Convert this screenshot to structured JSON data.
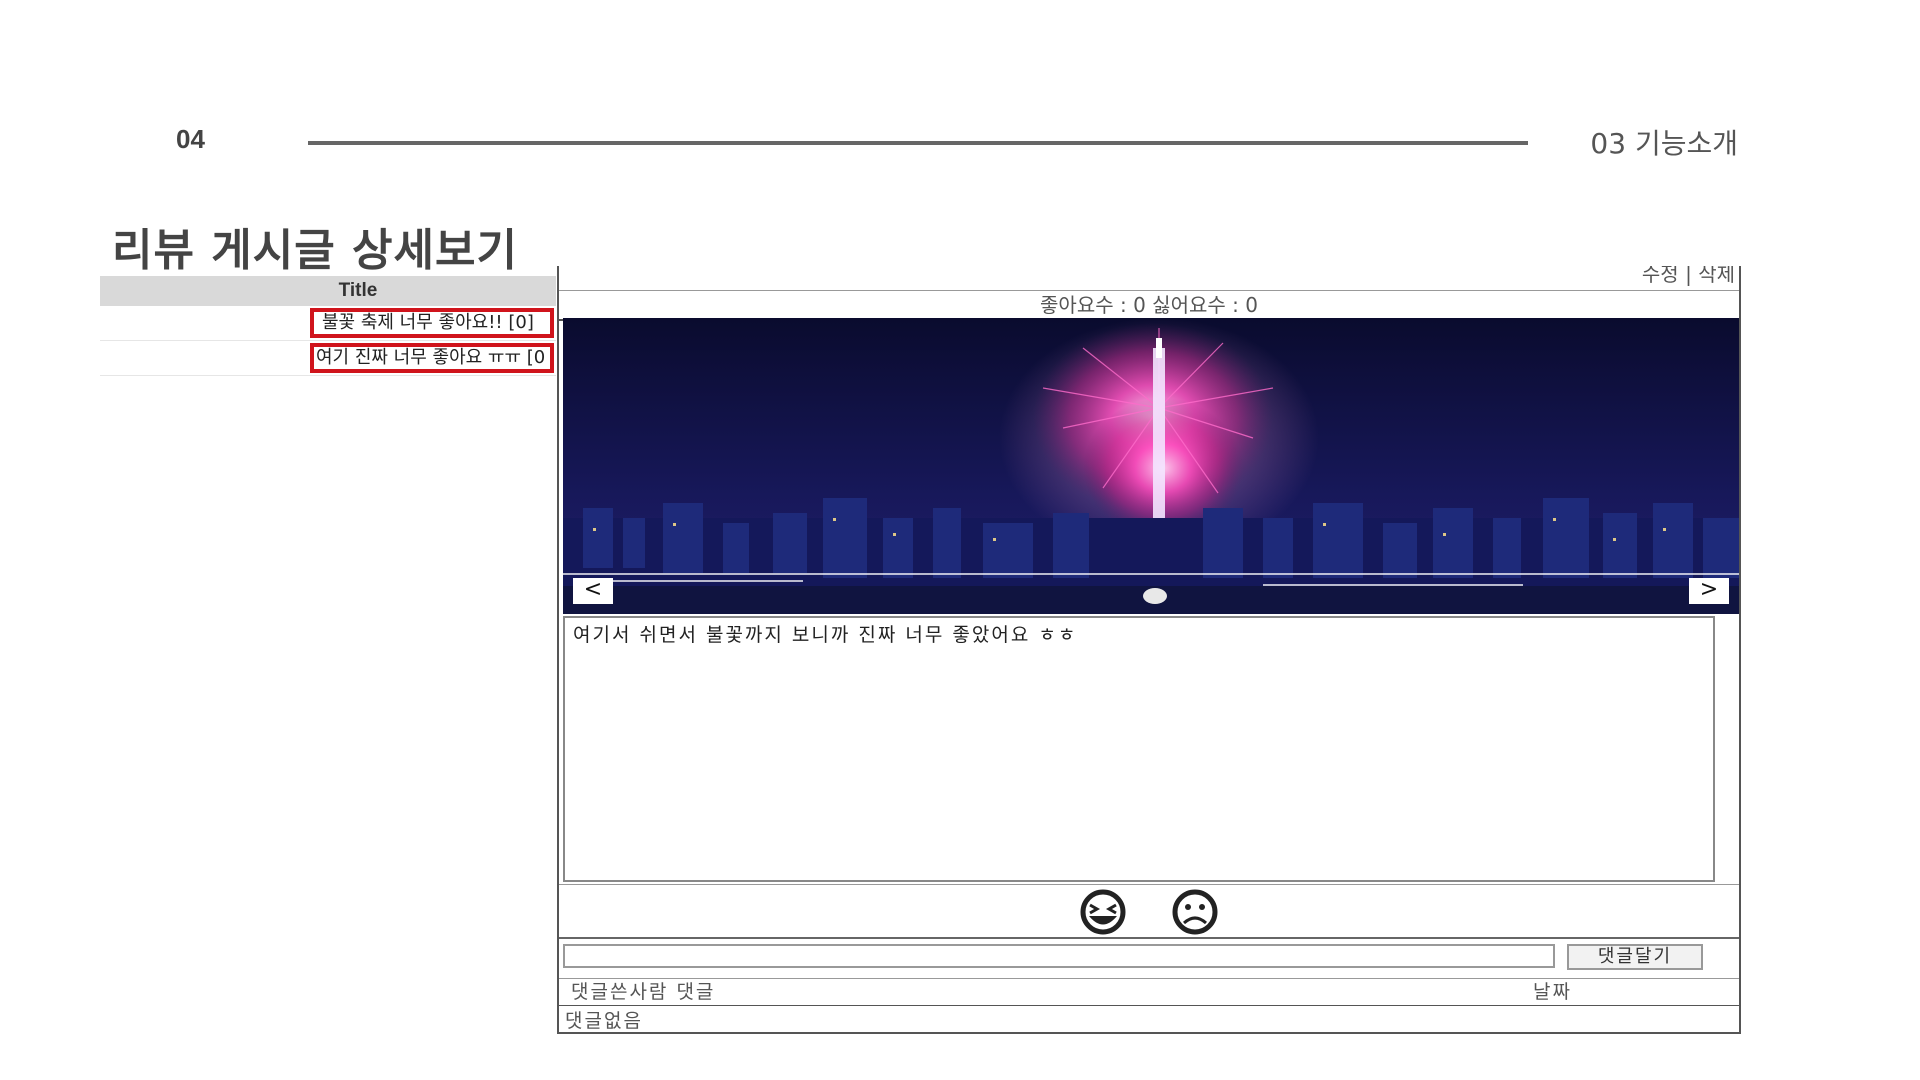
{
  "slide": {
    "page_number": "04",
    "section_label": "03 기능소개",
    "title": "리뷰 게시글 상세보기"
  },
  "review_list": {
    "header": "Title",
    "items": [
      {
        "title": "불꽃 축제 너무 좋아요!! [0]"
      },
      {
        "title": "여기 진짜 너무 좋아요 ㅠㅠ [0"
      }
    ]
  },
  "detail": {
    "edit_label": "수정",
    "separator": "|",
    "delete_label": "삭제",
    "counts_text": "좋아요수 : 0 싫어요수 : 0",
    "carousel": {
      "prev_label": "<",
      "next_label": ">"
    },
    "content": "여기서 쉬면서 불꽃까지 보니까 진짜 너무 좋았어요 ㅎㅎ",
    "reactions": [
      "laughing-face-icon",
      "sad-face-icon"
    ],
    "comment_button": "댓글달기",
    "comment_header_left": "댓글쓴사람 댓글",
    "comment_header_right": "날짜",
    "comment_empty": "댓글없음"
  }
}
